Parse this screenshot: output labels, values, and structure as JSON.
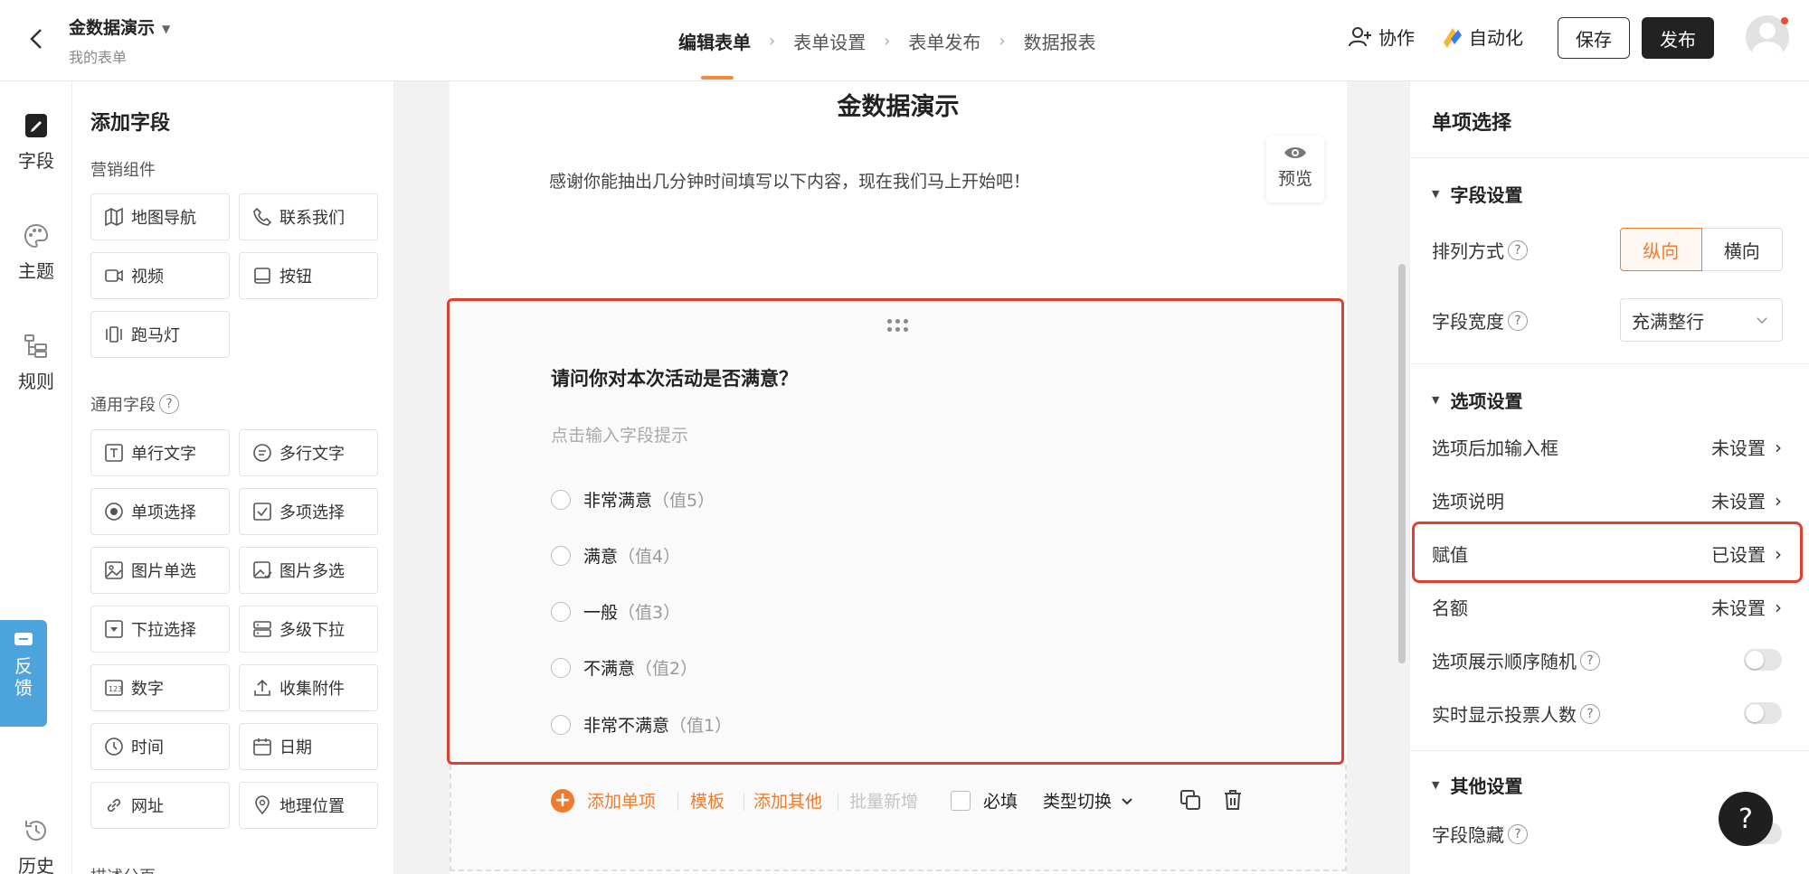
{
  "header": {
    "form_title": "金数据演示",
    "form_sub": "我的表单",
    "steps": [
      "编辑表单",
      "表单设置",
      "表单发布",
      "数据报表"
    ],
    "collab_label": "协作",
    "automation_label": "自动化",
    "save_label": "保存",
    "publish_label": "发布"
  },
  "rail": {
    "fields_label": "字段",
    "theme_label": "主题",
    "rules_label": "规则",
    "feedback_label": "反馈",
    "history_label": "历史"
  },
  "palette": {
    "title": "添加字段",
    "marketing_title": "营销组件",
    "marketing": [
      "地图导航",
      "联系我们",
      "视频",
      "按钮",
      "跑马灯"
    ],
    "common_title": "通用字段",
    "common": [
      "单行文字",
      "多行文字",
      "单项选择",
      "多项选择",
      "图片单选",
      "图片多选",
      "下拉选择",
      "多级下拉",
      "数字",
      "收集附件",
      "时间",
      "日期",
      "网址",
      "地理位置"
    ],
    "next_group": "描述分页"
  },
  "canvas": {
    "title": "金数据演示",
    "description": "感谢你能抽出几分钟时间填写以下内容，现在我们马上开始吧！",
    "preview_label": "预览",
    "question": "请问你对本次活动是否满意？",
    "hint": "点击输入字段提示",
    "options": [
      {
        "label": "非常满意",
        "value": "（值5）"
      },
      {
        "label": "满意",
        "value": "（值4）"
      },
      {
        "label": "一般",
        "value": "（值3）"
      },
      {
        "label": "不满意",
        "value": "（值2）"
      },
      {
        "label": "非常不满意",
        "value": "（值1）"
      }
    ],
    "toolbar": {
      "add_option": "添加单项",
      "template": "模板",
      "add_other": "添加其他",
      "batch_add": "批量新增",
      "required": "必填",
      "type_switch": "类型切换"
    }
  },
  "panel": {
    "title": "单项选择",
    "field_settings": "字段设置",
    "layout_label": "排列方式",
    "layout_vertical": "纵向",
    "layout_horizontal": "横向",
    "width_label": "字段宽度",
    "width_value": "充满整行",
    "option_settings": "选项设置",
    "rows": [
      {
        "label": "选项后加输入框",
        "value": "未设置"
      },
      {
        "label": "选项说明",
        "value": "未设置"
      },
      {
        "label": "赋值",
        "value": "已设置"
      },
      {
        "label": "名额",
        "value": "未设置"
      }
    ],
    "random_order_label": "选项展示顺序随机",
    "show_votes_label": "实时显示投票人数",
    "other_settings": "其他设置",
    "hide_field_label": "字段隐藏"
  },
  "colors": {
    "accent": "#ee7b2e",
    "highlight": "#e04030",
    "feedback": "#4da3db"
  }
}
